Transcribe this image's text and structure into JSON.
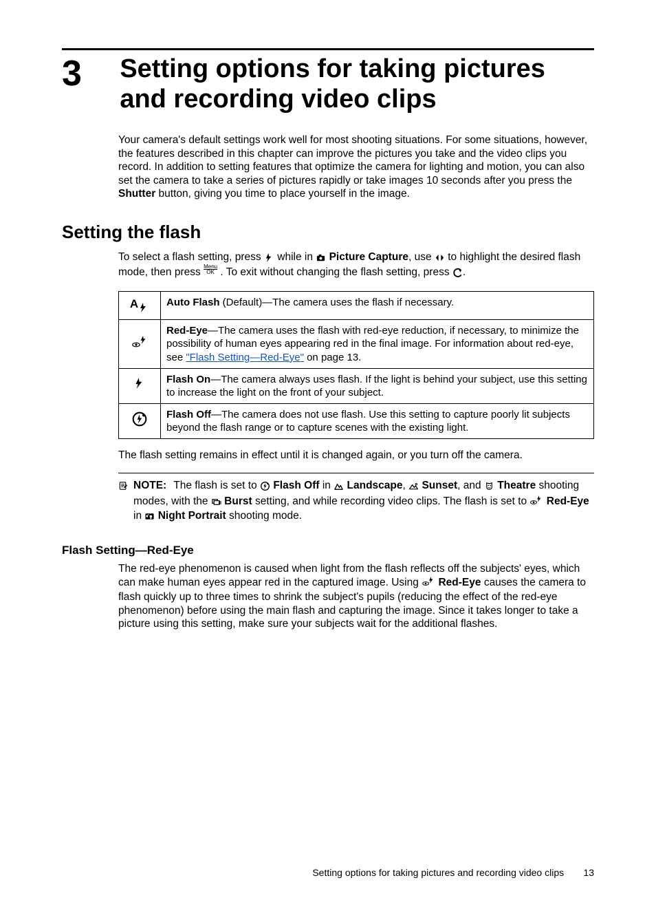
{
  "chapter": {
    "number": "3",
    "title": "Setting options for taking pictures and recording video clips"
  },
  "intro": {
    "part1": "Your camera's default settings work well for most shooting situations. For some situations, however, the features described in this chapter can improve the pictures you take and the video clips you record. In addition to setting features that optimize the camera for lighting and motion, you can also set the camera to take a series of pictures rapidly or take images 10 seconds after you press the ",
    "shutter": "Shutter",
    "part2": " button, giving you time to place yourself in the image."
  },
  "section_flash": {
    "heading": "Setting the flash",
    "p1a": "To select a flash setting, press ",
    "p1b": " while in ",
    "picture_capture": "Picture Capture",
    "p1c": ", use ",
    "p1d": " to highlight the desired flash mode, then press ",
    "p1e": ". To exit without changing the flash setting, press ",
    "p1f": "."
  },
  "flash_table": {
    "rows": [
      {
        "icon_name": "auto-flash-icon",
        "label": "Auto Flash",
        "suffix": " (Default)—The camera uses the flash if necessary."
      },
      {
        "icon_name": "red-eye-icon",
        "label": "Red-Eye",
        "suffix": "—The camera uses the flash with red-eye reduction, if necessary, to minimize the possibility of human eyes appearing red in the final image. For information about red-eye, see ",
        "link_text": "\"Flash Setting—Red-Eye\"",
        "after_link": " on page 13."
      },
      {
        "icon_name": "flash-on-icon",
        "label": "Flash On",
        "suffix": "—The camera always uses flash. If the light is behind your subject, use this setting to increase the light on the front of your subject."
      },
      {
        "icon_name": "flash-off-icon",
        "label": "Flash Off",
        "suffix": "—The camera does not use flash. Use this setting to capture poorly lit subjects beyond the flash range or to capture scenes with the existing light."
      }
    ]
  },
  "after_table": "The flash setting remains in effect until it is changed again, or you turn off the camera.",
  "note": {
    "label": "NOTE:",
    "t1": "The flash is set to ",
    "flash_off": "Flash Off",
    "t2": " in ",
    "landscape": "Landscape",
    "t3": ", ",
    "sunset": "Sunset",
    "t4": ", and ",
    "theatre": "Theatre",
    "t5": " shooting modes, with the ",
    "burst": "Burst",
    "t6": " setting, and while recording video clips. The flash is set to ",
    "red_eye": "Red-Eye",
    "t7": " in ",
    "night_portrait": "Night Portrait",
    "t8": " shooting mode."
  },
  "subsection_redeye": {
    "heading": "Flash Setting—Red-Eye",
    "p1a": "The red-eye phenomenon is caused when light from the flash reflects off the subjects' eyes, which can make human eyes appear red in the captured image. Using ",
    "red_eye": "Red-Eye",
    "p1b": " causes the camera to flash quickly up to three times to shrink the subject's pupils (reducing the effect of the red-eye phenomenon) before using the main flash and capturing the image. Since it takes longer to take a picture using this setting, make sure your subjects wait for the additional flashes."
  },
  "footer": {
    "text": "Setting options for taking pictures and recording video clips",
    "page": "13"
  },
  "glyphs": {
    "menu": "Menu",
    "ok": "OK"
  }
}
